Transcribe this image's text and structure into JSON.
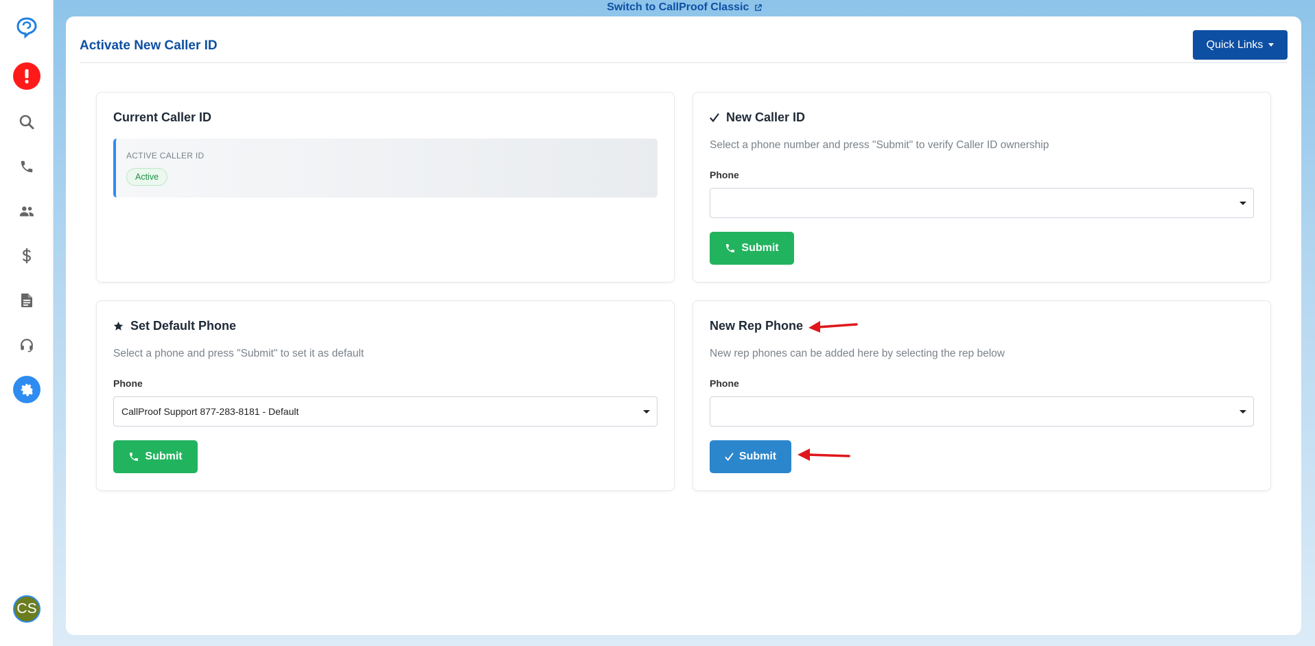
{
  "top_link": {
    "label": "Switch to CallProof Classic",
    "icon": "external-link-icon"
  },
  "sidebar": {
    "items": [
      {
        "icon": "callproof-logo-icon"
      },
      {
        "icon": "alert-icon",
        "color": "#ff1a1a"
      },
      {
        "icon": "search-icon"
      },
      {
        "icon": "phone-icon"
      },
      {
        "icon": "users-icon"
      },
      {
        "icon": "dollar-icon"
      },
      {
        "icon": "document-icon"
      },
      {
        "icon": "headset-icon"
      },
      {
        "icon": "gear-icon",
        "color": "#2e8cf0"
      }
    ],
    "avatar": {
      "initials": "CS"
    }
  },
  "page": {
    "title": "Activate New Caller ID",
    "quick_links_label": "Quick Links"
  },
  "current_caller": {
    "title": "Current Caller ID",
    "box_label": "ACTIVE CALLER ID",
    "status": "Active"
  },
  "new_caller": {
    "title": "New Caller ID",
    "title_icon": "check-icon",
    "description": "Select a phone number and press \"Submit\" to verify Caller ID ownership",
    "phone_label": "Phone",
    "phone_value": "",
    "submit_label": "Submit"
  },
  "default_phone": {
    "title": "Set Default Phone",
    "title_icon": "star-icon",
    "description": "Select a phone and press \"Submit\" to set it as default",
    "phone_label": "Phone",
    "phone_value": "CallProof Support 877-283-8181 - Default",
    "submit_label": "Submit"
  },
  "rep_phone": {
    "title": "New Rep Phone",
    "description": "New rep phones can be added here by selecting the rep below",
    "phone_label": "Phone",
    "phone_value": "",
    "submit_label": "Submit",
    "submit_icon": "check-icon"
  },
  "colors": {
    "brand_blue": "#0d4fa3",
    "accent_blue": "#2e8cf0",
    "success_green": "#22b35e",
    "submit_blue": "#2b86cc",
    "annotation_red": "#e0161b"
  }
}
